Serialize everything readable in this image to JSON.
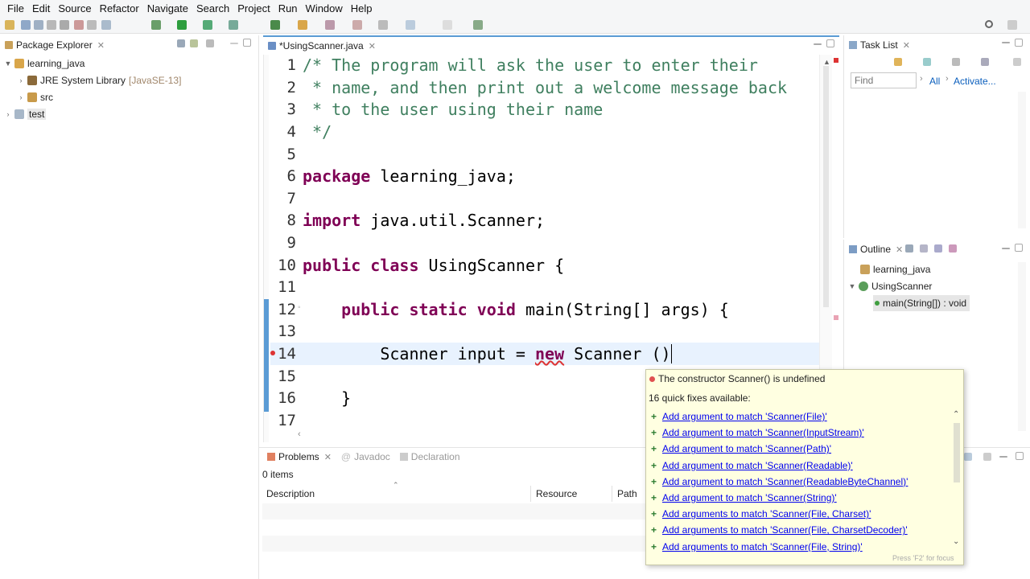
{
  "menu": [
    "File",
    "Edit",
    "Source",
    "Refactor",
    "Navigate",
    "Search",
    "Project",
    "Run",
    "Window",
    "Help"
  ],
  "package_explorer": {
    "tab_label": "Package Explorer",
    "items": [
      {
        "label": "learning_java",
        "suffix": ""
      },
      {
        "label": "JRE System Library",
        "suffix": "[JavaSE-13]"
      },
      {
        "label": "src",
        "suffix": ""
      },
      {
        "label": "test",
        "suffix": ""
      }
    ]
  },
  "editor": {
    "tab_label": "*UsingScanner.java",
    "lines": [
      {
        "num": "1",
        "segments": [
          {
            "t": "/* The program will ask the user to enter their",
            "c": "cm"
          }
        ]
      },
      {
        "num": "2",
        "segments": [
          {
            "t": " * name, and then print out a welcome message back",
            "c": "cm"
          }
        ]
      },
      {
        "num": "3",
        "segments": [
          {
            "t": " * to the user using their name",
            "c": "cm"
          }
        ]
      },
      {
        "num": "4",
        "segments": [
          {
            "t": " */",
            "c": "cm"
          }
        ]
      },
      {
        "num": "5",
        "segments": []
      },
      {
        "num": "6",
        "segments": [
          {
            "t": "package",
            "c": "kw"
          },
          {
            "t": " learning_java;",
            "c": "plain"
          }
        ]
      },
      {
        "num": "7",
        "segments": []
      },
      {
        "num": "8",
        "segments": [
          {
            "t": "import",
            "c": "kw"
          },
          {
            "t": " java.util.Scanner;",
            "c": "plain"
          }
        ]
      },
      {
        "num": "9",
        "segments": []
      },
      {
        "num": "10",
        "segments": [
          {
            "t": "public",
            "c": "kw"
          },
          {
            "t": " ",
            "c": "plain"
          },
          {
            "t": "class",
            "c": "kw"
          },
          {
            "t": " UsingScanner {",
            "c": "plain"
          }
        ]
      },
      {
        "num": "11",
        "segments": []
      },
      {
        "num": "12",
        "segments": [
          {
            "t": "    ",
            "c": "plain"
          },
          {
            "t": "public",
            "c": "kw"
          },
          {
            "t": " ",
            "c": "plain"
          },
          {
            "t": "static",
            "c": "kw"
          },
          {
            "t": " ",
            "c": "plain"
          },
          {
            "t": "void",
            "c": "kw"
          },
          {
            "t": " main(String[] args) {",
            "c": "plain"
          }
        ]
      },
      {
        "num": "13",
        "segments": []
      },
      {
        "num": "14",
        "segments": [
          {
            "t": "        Scanner input = ",
            "c": "plain"
          },
          {
            "t": "new",
            "c": "kw"
          },
          {
            "t": " Scanner (",
            "c": "plain"
          },
          {
            "t": ")",
            "c": "plain"
          }
        ]
      },
      {
        "num": "15",
        "segments": []
      },
      {
        "num": "16",
        "segments": [
          {
            "t": "    }",
            "c": "plain"
          }
        ]
      },
      {
        "num": "17",
        "segments": []
      }
    ]
  },
  "task_list": {
    "tab_label": "Task List",
    "find_placeholder": "Find",
    "all_label": "All",
    "activate_label": "Activate..."
  },
  "outline": {
    "tab_label": "Outline",
    "items": [
      "learning_java",
      "UsingScanner",
      "main(String[]) : void"
    ]
  },
  "bottom_tabs": {
    "problems": "Problems",
    "javadoc": "Javadoc",
    "declaration": "Declaration"
  },
  "problems": {
    "count": "0 items",
    "columns": [
      "Description",
      "Resource",
      "Path"
    ]
  },
  "quickfix": {
    "error": "The constructor Scanner() is undefined",
    "summary": "16 quick fixes available:",
    "fixes": [
      "Add argument to match 'Scanner(File)'",
      "Add argument to match 'Scanner(InputStream)'",
      "Add argument to match 'Scanner(Path)'",
      "Add argument to match 'Scanner(Readable)'",
      "Add argument to match 'Scanner(ReadableByteChannel)'",
      "Add argument to match 'Scanner(String)'",
      "Add arguments to match 'Scanner(File, Charset)'",
      "Add arguments to match 'Scanner(File, CharsetDecoder)'",
      "Add arguments to match 'Scanner(File, String)'"
    ],
    "footer": "Press 'F2' for focus"
  },
  "colors": {
    "keyword": "#7f0055",
    "comment": "#3f7f5f",
    "link": "#0000ee",
    "popup_bg": "#ffffe1"
  }
}
